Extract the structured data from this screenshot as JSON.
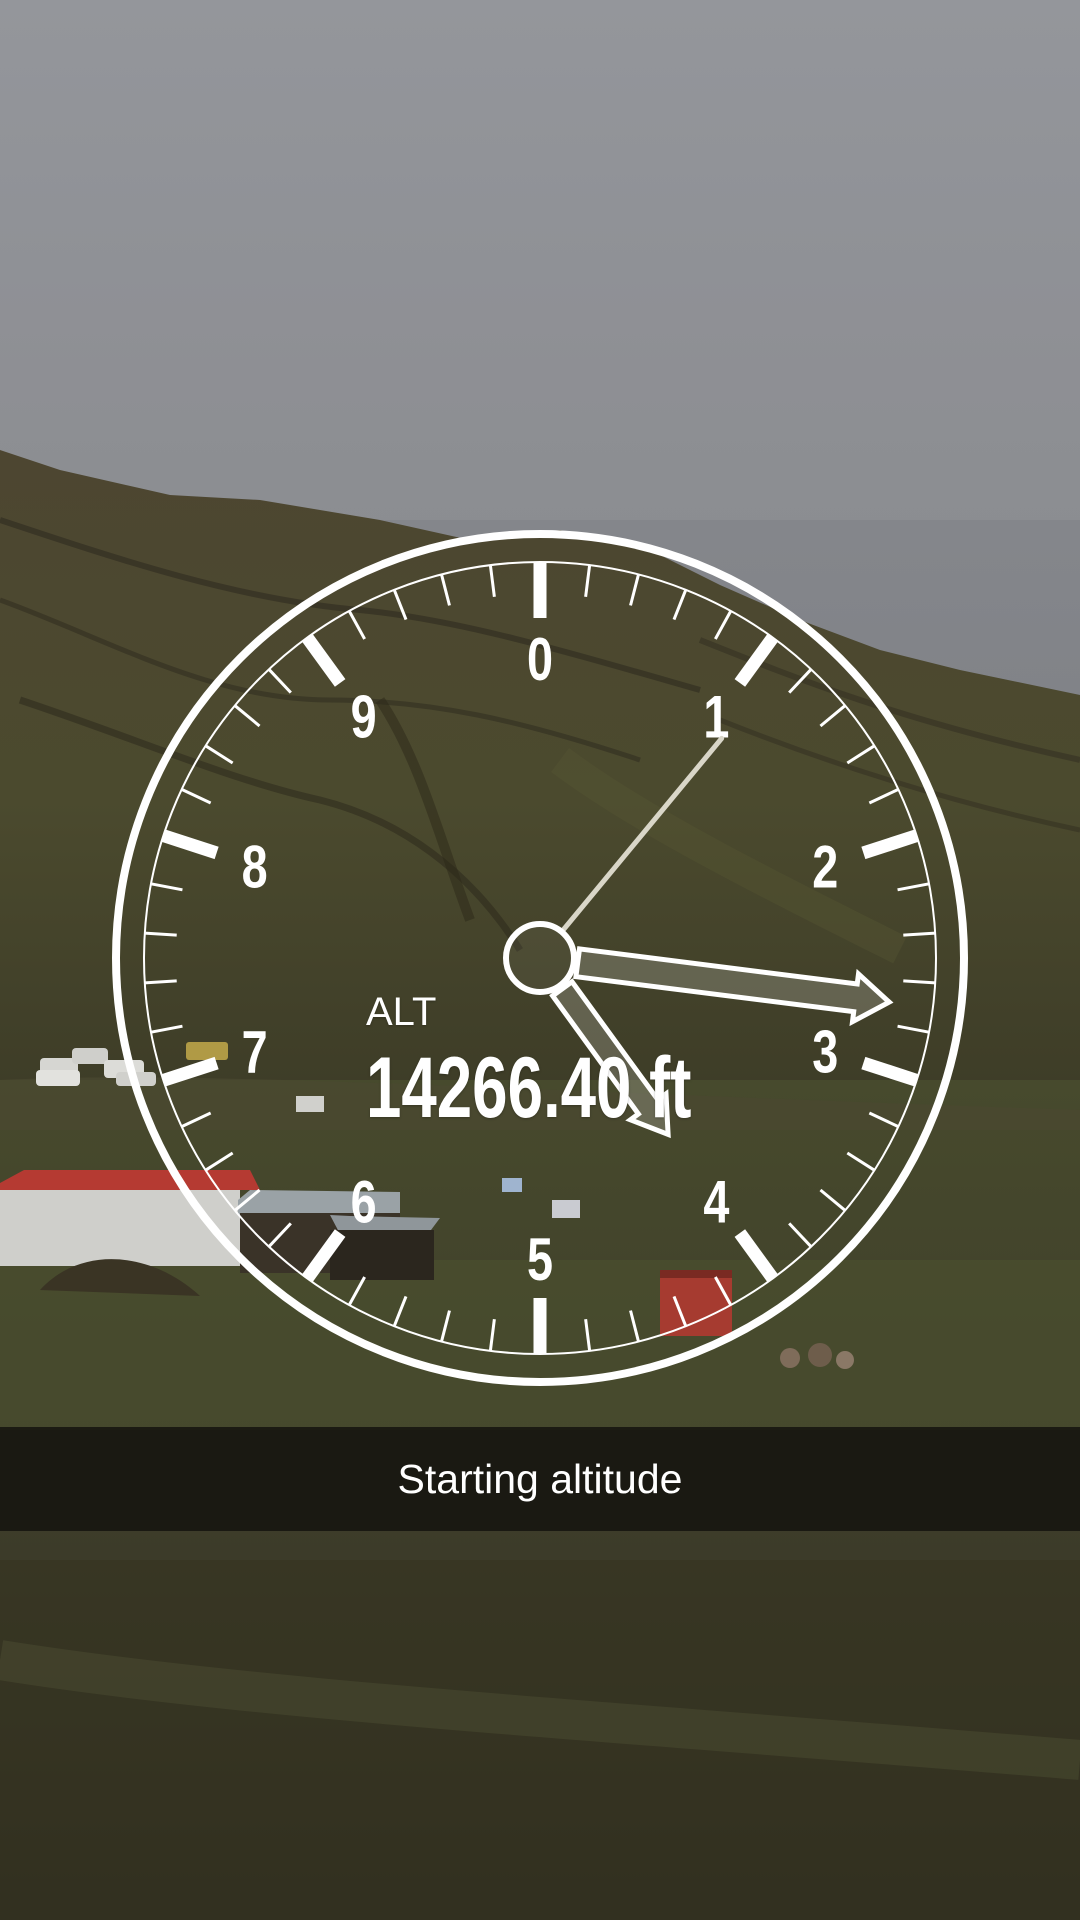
{
  "gauge": {
    "title": "ALT",
    "value_text": "14266.40 ft",
    "dial_numbers": [
      "0",
      "1",
      "2",
      "3",
      "4",
      "5",
      "6",
      "7",
      "8",
      "9"
    ],
    "hand_positions": {
      "long_hand": 1.1,
      "medium_hand": 2.7,
      "short_hand": 4.0
    }
  },
  "caption": {
    "text": "Starting altitude"
  },
  "colors": {
    "gauge_stroke": "#ffffff",
    "caption_bar": "#12110e",
    "sky_top": "#9fa1a6",
    "hill": "#4a4630",
    "roof_red": "#b53a32"
  }
}
